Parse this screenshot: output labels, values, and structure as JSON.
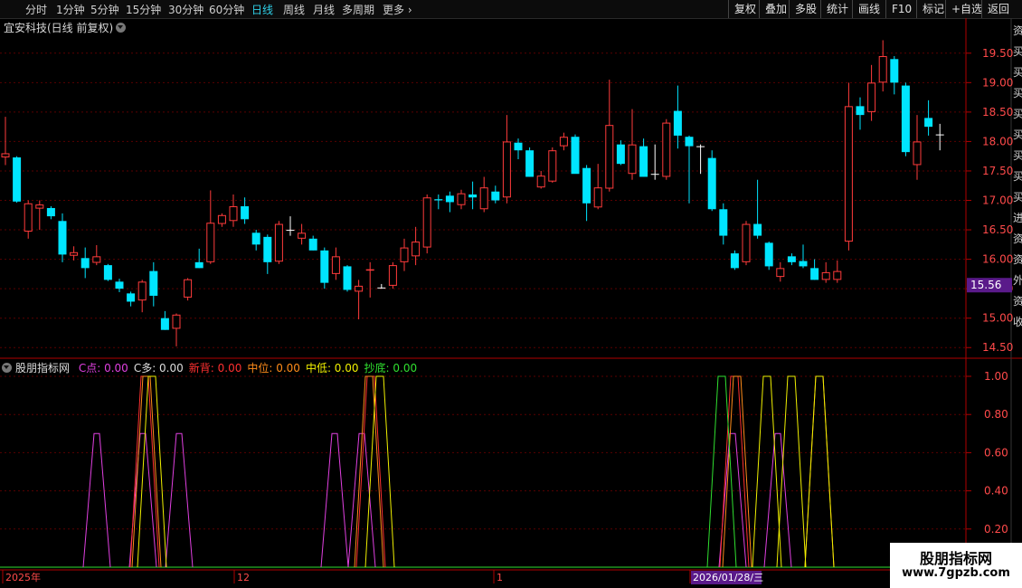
{
  "toolbar": {
    "periods": [
      "分时",
      "1分钟",
      "5分钟",
      "15分钟",
      "30分钟",
      "60分钟",
      "日线",
      "周线",
      "月线",
      "多周期",
      "更多"
    ],
    "active_period": "日线",
    "right_buttons": [
      "复权",
      "叠加",
      "多股",
      "统计",
      "画线",
      "F10",
      "标记",
      "+自选",
      "返回"
    ]
  },
  "stock_title": "宜安科技(日线 前复权)",
  "price_axis": {
    "labels": [
      "19.50",
      "19.00",
      "18.50",
      "18.00",
      "17.50",
      "17.00",
      "16.50",
      "16.00",
      "15.50",
      "15.00",
      "14.50"
    ],
    "current_price": "15.56"
  },
  "indicator": {
    "name": "股朋指标网",
    "items": [
      {
        "label": "C点: 0.00",
        "color": "#e040e0"
      },
      {
        "label": "C多: 0.00",
        "color": "#dddddd"
      },
      {
        "label": "新背: 0.00",
        "color": "#ff3030"
      },
      {
        "label": "中位: 0.00",
        "color": "#ff8c1a"
      },
      {
        "label": "中低: 0.00",
        "color": "#f0f000"
      },
      {
        "label": "抄底: 0.00",
        "color": "#30e030"
      }
    ],
    "axis_labels": [
      "1.00",
      "0.80",
      "0.60",
      "0.40",
      "0.20"
    ]
  },
  "date_axis": {
    "labels": [
      "2025年",
      "12",
      "1",
      "2026/01/28/三"
    ]
  },
  "right_strip": {
    "chars": [
      "资",
      "买",
      "买",
      "买",
      "买",
      "买",
      "买",
      "买",
      "买",
      "进",
      "资",
      "资",
      "外",
      "资",
      "收"
    ]
  },
  "watermark": {
    "line1": "股朋指标网",
    "line2": "www.7gpzb.com"
  },
  "colors": {
    "up": "#ff3b3b",
    "down": "#00e5ff",
    "doji": "#ffffff",
    "grid": "#5a0000",
    "axis": "#b00000"
  },
  "chart_data": {
    "type": "candlestick",
    "ylim": [
      14.35,
      19.85
    ],
    "candles": [
      {
        "o": 17.73,
        "h": 18.42,
        "l": 17.6,
        "c": 17.8
      },
      {
        "o": 17.73,
        "h": 17.75,
        "l": 16.96,
        "c": 16.98
      },
      {
        "o": 16.47,
        "h": 17.0,
        "l": 16.35,
        "c": 16.95
      },
      {
        "o": 16.86,
        "h": 17.0,
        "l": 16.5,
        "c": 16.93
      },
      {
        "o": 16.87,
        "h": 16.9,
        "l": 16.68,
        "c": 16.73
      },
      {
        "o": 16.65,
        "h": 16.78,
        "l": 15.95,
        "c": 16.08
      },
      {
        "o": 16.06,
        "h": 16.22,
        "l": 15.98,
        "c": 16.12
      },
      {
        "o": 16.02,
        "h": 16.2,
        "l": 15.68,
        "c": 15.85
      },
      {
        "o": 15.94,
        "h": 16.24,
        "l": 15.9,
        "c": 16.05
      },
      {
        "o": 15.9,
        "h": 15.92,
        "l": 15.63,
        "c": 15.65
      },
      {
        "o": 15.62,
        "h": 15.67,
        "l": 15.44,
        "c": 15.5
      },
      {
        "o": 15.42,
        "h": 15.45,
        "l": 15.2,
        "c": 15.28
      },
      {
        "o": 15.3,
        "h": 15.65,
        "l": 15.1,
        "c": 15.62
      },
      {
        "o": 15.8,
        "h": 15.95,
        "l": 15.2,
        "c": 15.38
      },
      {
        "o": 15.0,
        "h": 15.12,
        "l": 14.8,
        "c": 14.8
      },
      {
        "o": 14.82,
        "h": 15.08,
        "l": 14.52,
        "c": 15.06
      },
      {
        "o": 15.35,
        "h": 15.68,
        "l": 15.3,
        "c": 15.66
      },
      {
        "o": 15.95,
        "h": 16.18,
        "l": 15.85,
        "c": 15.85
      },
      {
        "o": 15.95,
        "h": 17.17,
        "l": 15.92,
        "c": 16.62
      },
      {
        "o": 16.6,
        "h": 16.78,
        "l": 16.55,
        "c": 16.75
      },
      {
        "o": 16.65,
        "h": 17.1,
        "l": 16.55,
        "c": 16.9
      },
      {
        "o": 16.9,
        "h": 17.05,
        "l": 16.6,
        "c": 16.68
      },
      {
        "o": 16.45,
        "h": 16.5,
        "l": 16.15,
        "c": 16.25
      },
      {
        "o": 16.38,
        "h": 16.42,
        "l": 15.75,
        "c": 15.95
      },
      {
        "o": 15.96,
        "h": 16.65,
        "l": 15.92,
        "c": 16.6
      },
      {
        "o": 16.5,
        "h": 16.73,
        "l": 16.4,
        "c": 16.5
      },
      {
        "o": 16.35,
        "h": 16.6,
        "l": 16.25,
        "c": 16.45
      },
      {
        "o": 16.35,
        "h": 16.4,
        "l": 16.15,
        "c": 16.15
      },
      {
        "o": 16.15,
        "h": 16.2,
        "l": 15.5,
        "c": 15.6
      },
      {
        "o": 15.75,
        "h": 16.2,
        "l": 15.65,
        "c": 16.05
      },
      {
        "o": 15.88,
        "h": 15.9,
        "l": 15.45,
        "c": 15.48
      },
      {
        "o": 15.45,
        "h": 15.65,
        "l": 14.98,
        "c": 15.55
      },
      {
        "o": 15.82,
        "h": 15.95,
        "l": 15.35,
        "c": 15.83
      },
      {
        "o": 15.52,
        "h": 15.58,
        "l": 15.5,
        "c": 15.52
      },
      {
        "o": 15.55,
        "h": 15.95,
        "l": 15.5,
        "c": 15.9
      },
      {
        "o": 15.95,
        "h": 16.35,
        "l": 15.8,
        "c": 16.2
      },
      {
        "o": 16.05,
        "h": 16.55,
        "l": 15.9,
        "c": 16.3
      },
      {
        "o": 16.2,
        "h": 17.1,
        "l": 16.1,
        "c": 17.05
      },
      {
        "o": 17.02,
        "h": 17.1,
        "l": 16.85,
        "c": 17.0
      },
      {
        "o": 17.08,
        "h": 17.15,
        "l": 16.8,
        "c": 16.97
      },
      {
        "o": 16.92,
        "h": 17.18,
        "l": 16.85,
        "c": 17.12
      },
      {
        "o": 17.1,
        "h": 17.32,
        "l": 16.85,
        "c": 17.05
      },
      {
        "o": 16.85,
        "h": 17.4,
        "l": 16.8,
        "c": 17.22
      },
      {
        "o": 17.15,
        "h": 17.25,
        "l": 16.95,
        "c": 17.0
      },
      {
        "o": 17.05,
        "h": 18.45,
        "l": 16.95,
        "c": 18.0
      },
      {
        "o": 17.98,
        "h": 18.05,
        "l": 17.7,
        "c": 17.85
      },
      {
        "o": 17.85,
        "h": 17.9,
        "l": 17.4,
        "c": 17.4
      },
      {
        "o": 17.22,
        "h": 17.5,
        "l": 17.2,
        "c": 17.42
      },
      {
        "o": 17.32,
        "h": 17.9,
        "l": 17.3,
        "c": 17.85
      },
      {
        "o": 17.92,
        "h": 18.15,
        "l": 17.85,
        "c": 18.08
      },
      {
        "o": 18.08,
        "h": 18.12,
        "l": 17.6,
        "c": 17.45
      },
      {
        "o": 17.55,
        "h": 17.6,
        "l": 16.65,
        "c": 16.95
      },
      {
        "o": 16.88,
        "h": 17.62,
        "l": 16.85,
        "c": 17.22
      },
      {
        "o": 17.2,
        "h": 19.05,
        "l": 17.15,
        "c": 18.28
      },
      {
        "o": 17.95,
        "h": 18.02,
        "l": 17.6,
        "c": 17.62
      },
      {
        "o": 17.45,
        "h": 18.55,
        "l": 17.35,
        "c": 17.95
      },
      {
        "o": 17.92,
        "h": 18.05,
        "l": 17.4,
        "c": 17.4
      },
      {
        "o": 17.45,
        "h": 17.95,
        "l": 17.35,
        "c": 17.45
      },
      {
        "o": 17.4,
        "h": 18.38,
        "l": 17.35,
        "c": 18.32
      },
      {
        "o": 18.52,
        "h": 18.95,
        "l": 17.88,
        "c": 18.1
      },
      {
        "o": 18.08,
        "h": 18.1,
        "l": 16.95,
        "c": 17.92
      },
      {
        "o": 17.92,
        "h": 17.95,
        "l": 17.45,
        "c": 17.92
      },
      {
        "o": 17.72,
        "h": 17.85,
        "l": 16.82,
        "c": 16.85
      },
      {
        "o": 16.85,
        "h": 16.95,
        "l": 16.25,
        "c": 16.4
      },
      {
        "o": 16.1,
        "h": 16.15,
        "l": 15.82,
        "c": 15.85
      },
      {
        "o": 15.95,
        "h": 16.65,
        "l": 15.9,
        "c": 16.6
      },
      {
        "o": 16.6,
        "h": 17.35,
        "l": 16.35,
        "c": 16.4
      },
      {
        "o": 16.28,
        "h": 16.3,
        "l": 15.82,
        "c": 15.88
      },
      {
        "o": 15.7,
        "h": 15.95,
        "l": 15.62,
        "c": 15.85
      },
      {
        "o": 16.05,
        "h": 16.1,
        "l": 15.9,
        "c": 15.95
      },
      {
        "o": 15.97,
        "h": 16.25,
        "l": 15.85,
        "c": 15.88
      },
      {
        "o": 15.85,
        "h": 16.0,
        "l": 15.65,
        "c": 15.65
      },
      {
        "o": 15.65,
        "h": 15.95,
        "l": 15.6,
        "c": 15.78
      },
      {
        "o": 15.65,
        "h": 15.98,
        "l": 15.6,
        "c": 15.8
      },
      {
        "o": 16.3,
        "h": 19.0,
        "l": 16.15,
        "c": 18.6
      },
      {
        "o": 18.6,
        "h": 18.75,
        "l": 18.2,
        "c": 18.45
      },
      {
        "o": 18.5,
        "h": 19.3,
        "l": 18.35,
        "c": 19.0
      },
      {
        "o": 19.0,
        "h": 19.72,
        "l": 18.85,
        "c": 19.45
      },
      {
        "o": 19.4,
        "h": 19.45,
        "l": 18.8,
        "c": 19.0
      },
      {
        "o": 18.95,
        "h": 19.0,
        "l": 17.75,
        "c": 17.82
      },
      {
        "o": 17.6,
        "h": 18.45,
        "l": 17.35,
        "c": 18.0
      },
      {
        "o": 18.4,
        "h": 18.7,
        "l": 18.1,
        "c": 18.25
      },
      {
        "o": 18.12,
        "h": 18.3,
        "l": 17.85,
        "c": 18.12
      }
    ],
    "indicator_series": [
      {
        "name": "C点",
        "color": "#e040e0",
        "peaks": [
          [
            107,
            0.7
          ],
          [
            158,
            0.7
          ],
          [
            198,
            0.7
          ],
          [
            370,
            0.7
          ],
          [
            400,
            0.7
          ],
          [
            810,
            0.7
          ],
          [
            860,
            0.7
          ]
        ]
      },
      {
        "name": "新背",
        "color": "#ff3030",
        "peaks": [
          [
            160,
            1.0
          ],
          [
            410,
            1.0
          ],
          [
            812,
            1.0
          ]
        ]
      },
      {
        "name": "中位",
        "color": "#ff8c1a",
        "peaks": [
          [
            162,
            1.0
          ],
          [
            408,
            1.0
          ],
          [
            815,
            1.0
          ],
          [
            906,
            1.0
          ]
        ]
      },
      {
        "name": "中低",
        "color": "#f0f000",
        "peaks": [
          [
            168,
            1.0
          ],
          [
            420,
            1.0
          ],
          [
            848,
            1.0
          ],
          [
            875,
            1.0
          ],
          [
            906,
            1.0
          ]
        ]
      },
      {
        "name": "抄底",
        "color": "#30e030",
        "peaks": [
          [
            798,
            1.0
          ]
        ]
      }
    ]
  }
}
